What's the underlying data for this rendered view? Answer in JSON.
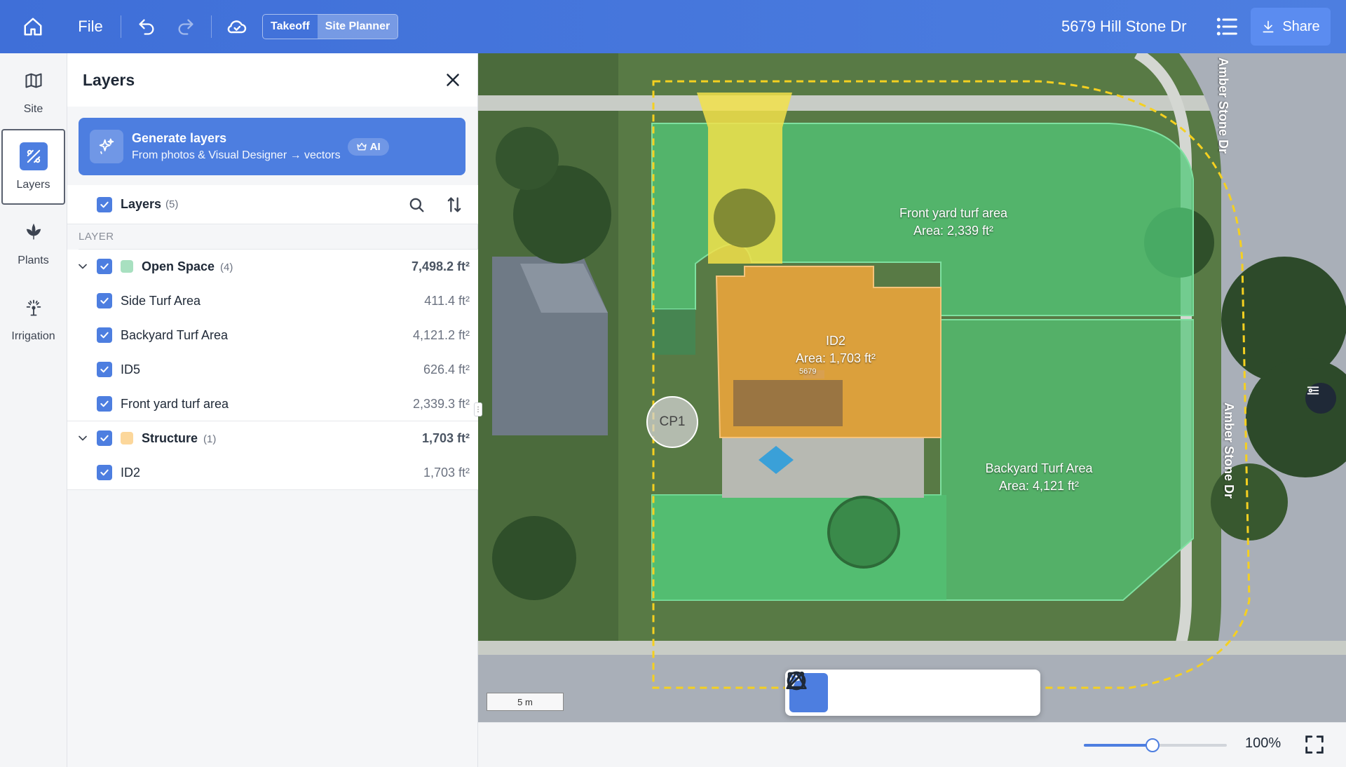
{
  "topbar": {
    "file_label": "File",
    "mode_takeoff": "Takeoff",
    "mode_site_planner": "Site Planner",
    "address": "5679 Hill Stone Dr",
    "share_label": "Share"
  },
  "rail": {
    "items": [
      {
        "label": "Site",
        "icon": "map-icon"
      },
      {
        "label": "Layers",
        "icon": "layers-icon",
        "active": true
      },
      {
        "label": "Plants",
        "icon": "plant-icon"
      },
      {
        "label": "Irrigation",
        "icon": "sprinkler-icon"
      }
    ]
  },
  "panel": {
    "title": "Layers",
    "generate": {
      "title": "Generate layers",
      "subtitle": "From photos & Visual Designer → vectors",
      "badge": "AI"
    },
    "layers_header": {
      "label": "Layers",
      "count": "(5)"
    },
    "column_header": "LAYER",
    "groups": [
      {
        "name": "Open Space",
        "count": "(4)",
        "area": "7,498.2 ft²",
        "color": "#a8e0c0",
        "items": [
          {
            "name": "Side Turf Area",
            "area": "411.4 ft²"
          },
          {
            "name": "Backyard Turf Area",
            "area": "4,121.2 ft²"
          },
          {
            "name": "ID5",
            "area": "626.4 ft²"
          },
          {
            "name": "Front yard turf area",
            "area": "2,339.3 ft²"
          }
        ]
      },
      {
        "name": "Structure",
        "count": "(1)",
        "area": "1,703 ft²",
        "color": "#fcd79b",
        "items": [
          {
            "name": "ID2",
            "area": "1,703 ft²"
          }
        ]
      }
    ]
  },
  "map": {
    "labels": {
      "front_yard_name": "Front yard turf area",
      "front_yard_area": "Area: 2,339 ft²",
      "id2_name": "ID2",
      "id2_area": "Area: 1,703 ft²",
      "backyard_name": "Backyard Turf Area",
      "backyard_area": "Area: 4,121 ft²",
      "street_top": "Amber Stone Dr",
      "street_right": "Amber Stone Dr",
      "house_number": "5679",
      "cp1": "CP1",
      "scale": "5 m"
    },
    "colors": {
      "turf": "#52c878",
      "structure": "#f2a73b",
      "driveway": "#f2e04a",
      "property_line": "#f5d020"
    },
    "draw_tools": [
      "select-tool",
      "polygon-tool",
      "rectangle-tool",
      "circle-tool",
      "triangle-tool",
      "line-tool"
    ]
  },
  "bottom": {
    "zoom_label": "100%",
    "zoom_level": 0.48
  }
}
